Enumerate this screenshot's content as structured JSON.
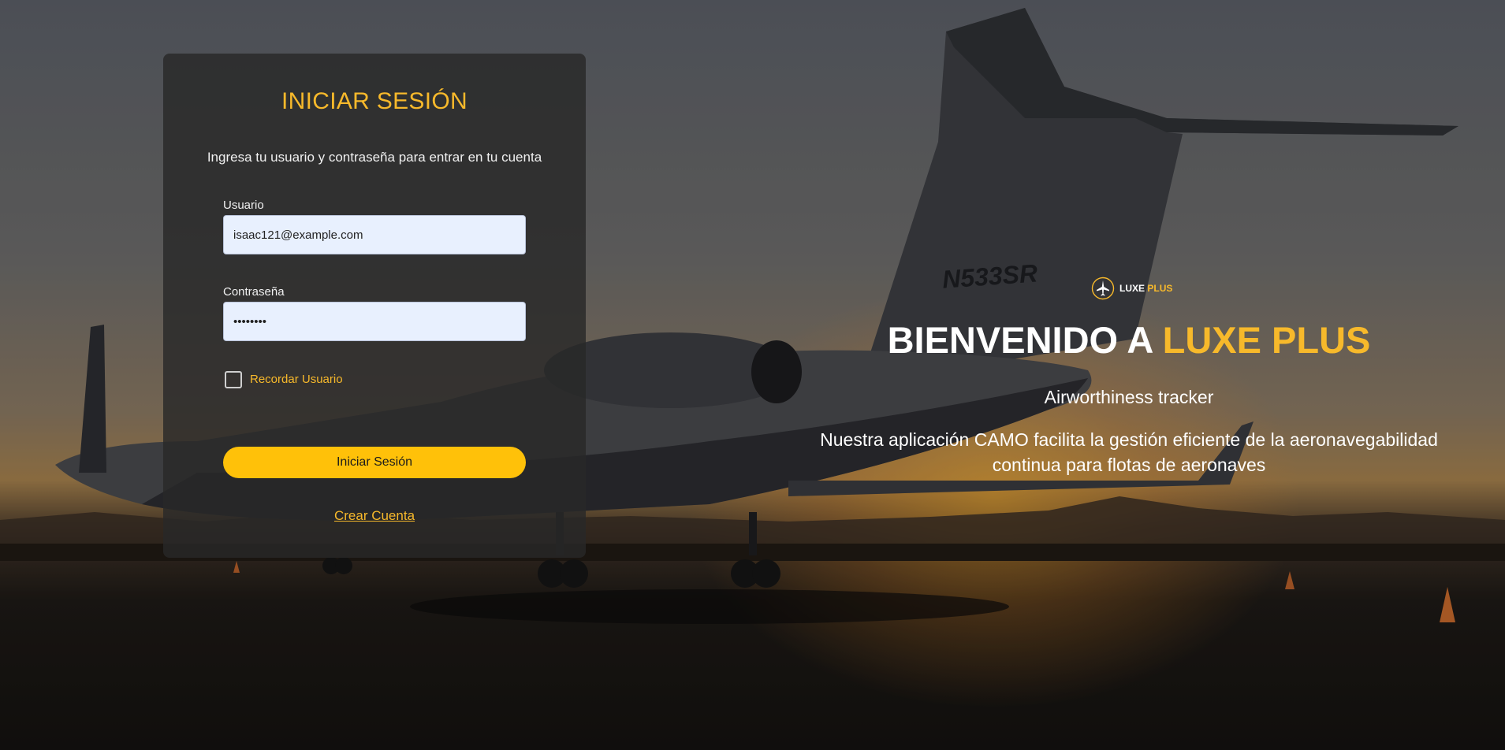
{
  "login": {
    "title": "INICIAR SESIÓN",
    "subtitle": "Ingresa tu usuario y contraseña para entrar en tu cuenta",
    "username_label": "Usuario",
    "username_value": "isaac121@example.com",
    "password_label": "Contraseña",
    "password_value": "12345678",
    "remember_label": "Recordar Usuario",
    "remember_checked": false,
    "submit_label": "Iniciar Sesión",
    "create_account_label": "Crear Cuenta"
  },
  "brand": {
    "logo_icon": "airplane-circle-icon",
    "name_main": "LUXE",
    "name_accent": "PLUS"
  },
  "hero": {
    "title_main": "BIENVENIDO A ",
    "title_accent": "LUXE PLUS",
    "tagline": "Airworthiness tracker",
    "description": "Nuestra aplicación CAMO facilita la gestión eficiente de la aeronavegabilidad continua para flotas de aeronaves"
  },
  "background": {
    "aircraft_registration": "N533SR"
  },
  "colors": {
    "accent": "#f7b92b",
    "button": "#ffc109",
    "panel": "#282828",
    "input_bg": "#e8f0fe"
  }
}
